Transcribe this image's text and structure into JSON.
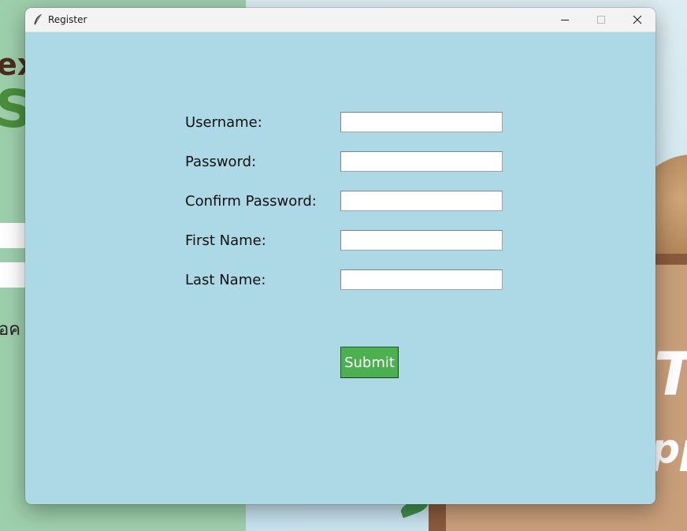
{
  "window": {
    "title": "Register",
    "controls": {
      "minimize_icon": "minimize-icon",
      "maximize_icon": "maximize-icon",
      "close_icon": "close-icon"
    }
  },
  "form": {
    "fields": [
      {
        "label": "Username:",
        "value": ""
      },
      {
        "label": "Password:",
        "value": ""
      },
      {
        "label": "Confirm Password:",
        "value": ""
      },
      {
        "label": "First Name:",
        "value": ""
      },
      {
        "label": "Last Name:",
        "value": ""
      }
    ],
    "submit_label": "Submit"
  },
  "background": {
    "text_brown": "ex",
    "text_green": "Sl",
    "text_thai": "อค",
    "text_white_1": "Th",
    "text_white_2": "pp"
  },
  "colors": {
    "client_bg": "#add8e6",
    "titlebar_bg": "#f3f3f3",
    "submit_bg": "#4caf50",
    "submit_text": "#ffffff"
  }
}
